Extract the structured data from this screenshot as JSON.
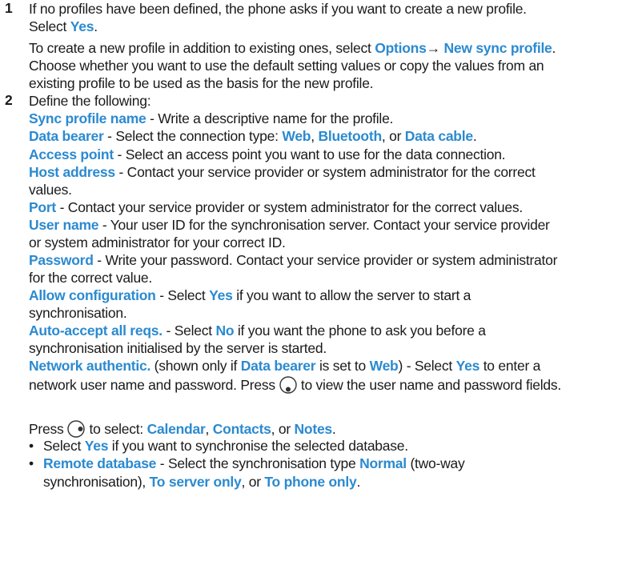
{
  "step1": {
    "number": "1",
    "l1": "If no profiles have been defined, the phone asks if you want to create a new profile.",
    "l2_pre": "Select ",
    "l2_yes": "Yes",
    "l2_post": ".",
    "l3_pre": "To create a new profile in addition to existing ones, select ",
    "l3_options": "Options",
    "l3_arrow": "→ ",
    "l3_newsync": "New sync profile",
    "l3_post": ".",
    "l4": "Choose whether you want to use the default setting values or copy the values from an",
    "l5": "existing profile to be used as the basis for the new profile."
  },
  "step2": {
    "number": "2",
    "intro": "Define the following:",
    "sync_name_term": "Sync profile name",
    "sync_name_desc": " - Write a descriptive name for the profile.",
    "bearer_term": "Data bearer",
    "bearer_desc": " - Select the connection type: ",
    "bearer_web": "Web",
    "comma1": ", ",
    "bearer_bt": "Bluetooth",
    "or1": ", or ",
    "bearer_cable": "Data cable",
    "period1": ".",
    "ap_term": "Access point",
    "ap_desc": " - Select an access point you want to use for the data connection.",
    "host_term": "Host address",
    "host_desc1": " - Contact your service provider or system administrator for the correct",
    "host_desc2": "values.",
    "port_term": "Port",
    "port_desc": " - Contact your service provider or system administrator for the correct values.",
    "user_term": "User name",
    "user_desc1": " - Your user ID for the synchronisation server. Contact your service provider",
    "user_desc2": "or system administrator for your correct ID.",
    "pw_term": "Password",
    "pw_desc1": " - Write your password. Contact your service provider or system administrator",
    "pw_desc2": "for the correct value.",
    "allow_term": "Allow configuration",
    "allow_pre": " - Select ",
    "allow_yes": "Yes",
    "allow_post": " if you want to allow the server to start a",
    "allow_desc2": "synchronisation.",
    "auto_term": "Auto-accept all reqs.",
    "auto_pre": " - Select ",
    "auto_no": "No",
    "auto_post": " if you want the phone to ask you before a",
    "auto_desc2": "synchronisation initialised by the server is started.",
    "net_term": "Network authentic.",
    "net_pre": " (shown only if ",
    "net_bearer": "Data bearer",
    "net_mid": " is set to ",
    "net_web": "Web",
    "net_post": ") - Select ",
    "net_yes": "Yes",
    "net_end": " to enter a",
    "net_line2_pre": "network user name and password. Press",
    "net_line2_post": "to view the user name and password fields."
  },
  "press": {
    "pre": "Press",
    "mid": "to select: ",
    "calendar": "Calendar",
    "c1": ", ",
    "contacts": "Contacts",
    "c2": ", or ",
    "notes": "Notes",
    "end": "."
  },
  "bullets": {
    "b1_pre": "Select ",
    "b1_yes": "Yes",
    "b1_post": " if you want to synchronise the selected database.",
    "b2_term": "Remote database",
    "b2_pre": " - Select the synchronisation type ",
    "b2_normal": "Normal",
    "b2_post": " (two-way",
    "b2_l2_pre": "synchronisation), ",
    "b2_server": "To server only",
    "b2_or": ", or ",
    "b2_phone": "To phone only",
    "b2_end": "."
  },
  "icons": {
    "down_key": "joystick-down-icon",
    "right_key": "joystick-right-icon"
  },
  "colors": {
    "highlight": "#2b8ad0",
    "text": "#1a1a1a"
  }
}
